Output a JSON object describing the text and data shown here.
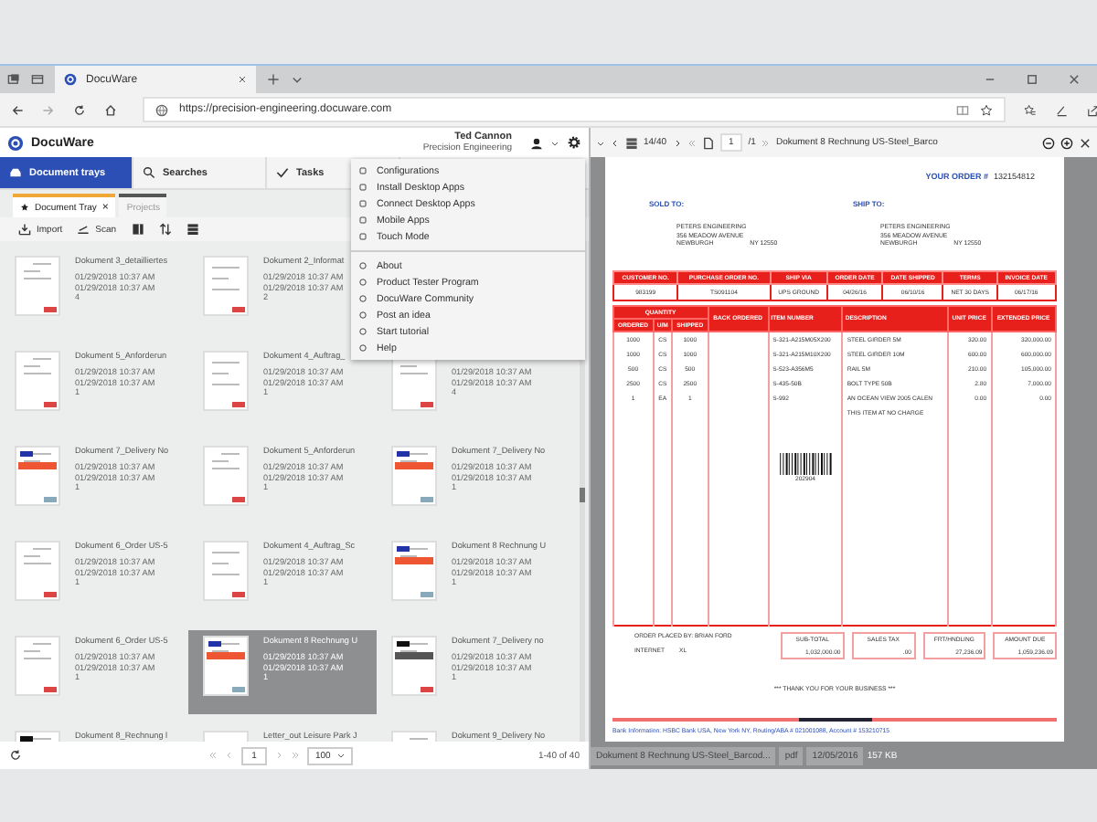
{
  "browser": {
    "tab_title": "DocuWare",
    "url": "https://precision-engineering.docuware.com"
  },
  "app_header": {
    "logo": "DocuWare",
    "user_name": "Ted Cannon",
    "organization": "Precision Engineering"
  },
  "nav_tabs": [
    {
      "label": "Document trays",
      "selected": true
    },
    {
      "label": "Searches",
      "selected": false
    },
    {
      "label": "Tasks",
      "selected": false
    }
  ],
  "tray_tabs": [
    {
      "label": "Document Tray",
      "selected": true,
      "close": "×"
    },
    {
      "label": "Projects",
      "selected": false
    }
  ],
  "toolbar": {
    "import": "Import",
    "scan": "Scan"
  },
  "settings_menu": {
    "items": [
      {
        "label": "Configurations"
      },
      {
        "label": "Install Desktop Apps"
      },
      {
        "label": "Connect Desktop Apps"
      },
      {
        "label": "Mobile Apps"
      },
      {
        "label": "Touch Mode"
      }
    ],
    "items_2": [
      {
        "label": "About"
      },
      {
        "label": "Product Tester Program"
      },
      {
        "label": "DocuWare Community"
      },
      {
        "label": "Post an idea"
      },
      {
        "label": "Start tutorial"
      },
      {
        "label": "Help"
      }
    ]
  },
  "documents": [
    {
      "title": "Dokument 3_detailliertes",
      "created": "01/29/2018 10:37 AM",
      "modified": "01/29/2018 10:37 AM",
      "pages": "4",
      "kind": "plain",
      "selected": false
    },
    {
      "title": "Dokument 2_Informat",
      "created": "01/29/2018 10:37 AM",
      "modified": "01/29/2018 10:37 AM",
      "pages": "2",
      "kind": "letter",
      "selected": false
    },
    {
      "kind": "hidden"
    },
    {
      "title": "Dokument 5_Anforderun",
      "created": "01/29/2018 10:37 AM",
      "modified": "01/29/2018 10:37 AM",
      "pages": "1",
      "kind": "plain",
      "selected": false
    },
    {
      "title": "Dokument 4_Auftrag_",
      "created": "01/29/2018 10:37 AM",
      "modified": "01/29/2018 10:37 AM",
      "pages": "1",
      "kind": "letter",
      "selected": false
    },
    {
      "created": "01/29/2018 10:37 AM",
      "modified": "01/29/2018 10:37 AM",
      "pages": "4",
      "kind": "plain",
      "selected": false
    },
    {
      "title": "Dokument 7_Delivery No",
      "created": "01/29/2018 10:37 AM",
      "modified": "01/29/2018 10:37 AM",
      "pages": "1",
      "kind": "red",
      "selected": false
    },
    {
      "title": "Dokument 5_Anforderun",
      "created": "01/29/2018 10:37 AM",
      "modified": "01/29/2018 10:37 AM",
      "pages": "1",
      "kind": "plain",
      "selected": false
    },
    {
      "title": "Dokument 7_Delivery No",
      "created": "01/29/2018 10:37 AM",
      "modified": "01/29/2018 10:37 AM",
      "pages": "1",
      "kind": "red",
      "selected": false
    },
    {
      "title": "Dokument 6_Order US-5",
      "created": "01/29/2018 10:37 AM",
      "modified": "01/29/2018 10:37 AM",
      "pages": "1",
      "kind": "plain",
      "selected": false
    },
    {
      "title": "Dokument 4_Auftrag_Sc",
      "created": "01/29/2018 10:37 AM",
      "modified": "01/29/2018 10:37 AM",
      "pages": "1",
      "kind": "letter",
      "selected": false
    },
    {
      "title": "Dokument 8 Rechnung U",
      "created": "01/29/2018 10:37 AM",
      "modified": "01/29/2018 10:37 AM",
      "pages": "1",
      "kind": "red",
      "selected": false
    },
    {
      "title": "Dokument 6_Order US-5",
      "created": "01/29/2018 10:37 AM",
      "modified": "01/29/2018 10:37 AM",
      "pages": "1",
      "kind": "plain",
      "selected": false
    },
    {
      "title": "Dokument 8 Rechnung U",
      "created": "01/29/2018 10:37 AM",
      "modified": "01/29/2018 10:37 AM",
      "pages": "1",
      "kind": "red",
      "selected": true
    },
    {
      "title": "Dokument 7_Delivery no",
      "created": "01/29/2018 10:37 AM",
      "modified": "01/29/2018 10:37 AM",
      "pages": "1",
      "kind": "dark",
      "selected": false
    },
    {
      "title": "Dokument 8_Rechnung l",
      "kind": "dark",
      "selected": false
    },
    {
      "title": "Letter_out Leisure Park J",
      "kind": "letter",
      "selected": false
    },
    {
      "title": "Dokument 9_Delivery No",
      "kind": "plain",
      "selected": false
    }
  ],
  "pagination": {
    "page": "1",
    "page_size": "100",
    "range": "1-40 of 40"
  },
  "viewer_toolbar": {
    "position": "14/40",
    "page": "1",
    "page_count": "/1",
    "document_title": "Dokument 8 Rechnung US-Steel_Barco"
  },
  "invoice": {
    "order_label": "YOUR ORDER #",
    "order_number": "132154812",
    "sold_to": {
      "label": "SOLD TO:",
      "lines": [
        "PETERS ENGINEERING",
        "356 MEADOW AVENUE"
      ],
      "city": "NEWBURGH",
      "state_zip": "NY 12550"
    },
    "ship_to": {
      "label": "SHIP TO:",
      "lines": [
        "PETERS ENGINEERING",
        "356 MEADOW AVENUE"
      ],
      "city": "NEWBURGH",
      "state_zip": "NY 12550"
    },
    "header_columns": [
      "CUSTOMER NO.",
      "PURCHASE ORDER NO.",
      "SHIP VIA",
      "ORDER DATE",
      "DATE SHIPPED",
      "TERMS",
      "INVOICE DATE"
    ],
    "header_values": [
      "983199",
      "TS091104",
      "UPS GROUND",
      "04/26/16",
      "06/10/16",
      "NET 30 DAYS",
      "06/17/16"
    ],
    "quantity_label": "QUANTITY",
    "item_columns": [
      "ORDERED",
      "U/M",
      "SHIPPED",
      "BACK ORDERED",
      "ITEM NUMBER",
      "DESCRIPTION",
      "UNIT PRICE",
      "EXTENDED PRICE"
    ],
    "items": [
      {
        "ordered": "1000",
        "unit": "CS",
        "shipped": "1000",
        "item_number": "S-321-A215M05X200",
        "description": "STEEL GIRDER 5M",
        "unit_price": "320.00",
        "extended_price": "320,000.00"
      },
      {
        "ordered": "1000",
        "unit": "CS",
        "shipped": "1000",
        "item_number": "S-321-A215M10X200",
        "description": "STEEL GIRDER 10M",
        "unit_price": "600.00",
        "extended_price": "600,000.00"
      },
      {
        "ordered": "500",
        "unit": "CS",
        "shipped": "500",
        "item_number": "S-523-A356M5",
        "description": "RAIL 5M",
        "unit_price": "210.00",
        "extended_price": "105,000.00"
      },
      {
        "ordered": "2500",
        "unit": "CS",
        "shipped": "2500",
        "item_number": "S-435-50B",
        "description": "BOLT TYPE 50B",
        "unit_price": "2.80",
        "extended_price": "7,000.00"
      },
      {
        "ordered": "1",
        "unit": "EA",
        "shipped": "1",
        "item_number": "S-992",
        "description": "AN OCEAN VIEW 2005 CALEN",
        "unit_price": "0.00",
        "extended_price": "0.00"
      }
    ],
    "item_note": "THIS ITEM AT NO CHARGE",
    "barcode_number": "202904",
    "placed_by": "ORDER PLACED BY: BRIAN FORD",
    "channel": "INTERNET",
    "channel_code": "XL",
    "totals": [
      {
        "label": "SUB-TOTAL",
        "value": "1,032,000.00"
      },
      {
        "label": "SALES TAX",
        "value": ".00"
      },
      {
        "label": "FRT/HNDLING",
        "value": "27,236.09"
      },
      {
        "label": "AMOUNT DUE",
        "value": "1,059,236.09"
      }
    ],
    "thanks": "*** THANK YOU FOR YOUR BUSINESS ***",
    "bank": "Bank Information: HSBC Bank USA, New York NY, Routing/ABA # 021001088, Account # 153210715"
  },
  "viewer_footer": {
    "file_name": "Dokument 8 Rechnung US-Steel_Barcod...",
    "type": "pdf",
    "date": "12/05/2016",
    "size": "157 KB"
  }
}
